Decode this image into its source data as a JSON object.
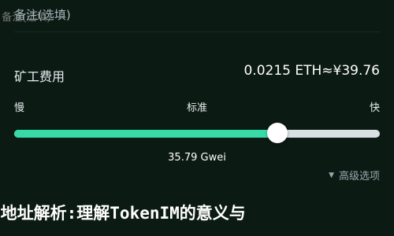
{
  "remark": {
    "placeholder": "备注(选填)"
  },
  "fee": {
    "label": "矿工费用",
    "value": "0.0215 ETH≈¥39.76"
  },
  "speed": {
    "slow": "慢",
    "standard": "标准",
    "fast": "快",
    "level_percent": 72
  },
  "gas_price": "35.79 Gwei",
  "advanced": {
    "icon": "triangle-down-icon",
    "label": "高级选项"
  },
  "caption": "n地址解析:理解TokenIM的意义与",
  "colors": {
    "background": "#0b1a12",
    "accent": "#38d9a9",
    "track": "#d9dfe3"
  }
}
